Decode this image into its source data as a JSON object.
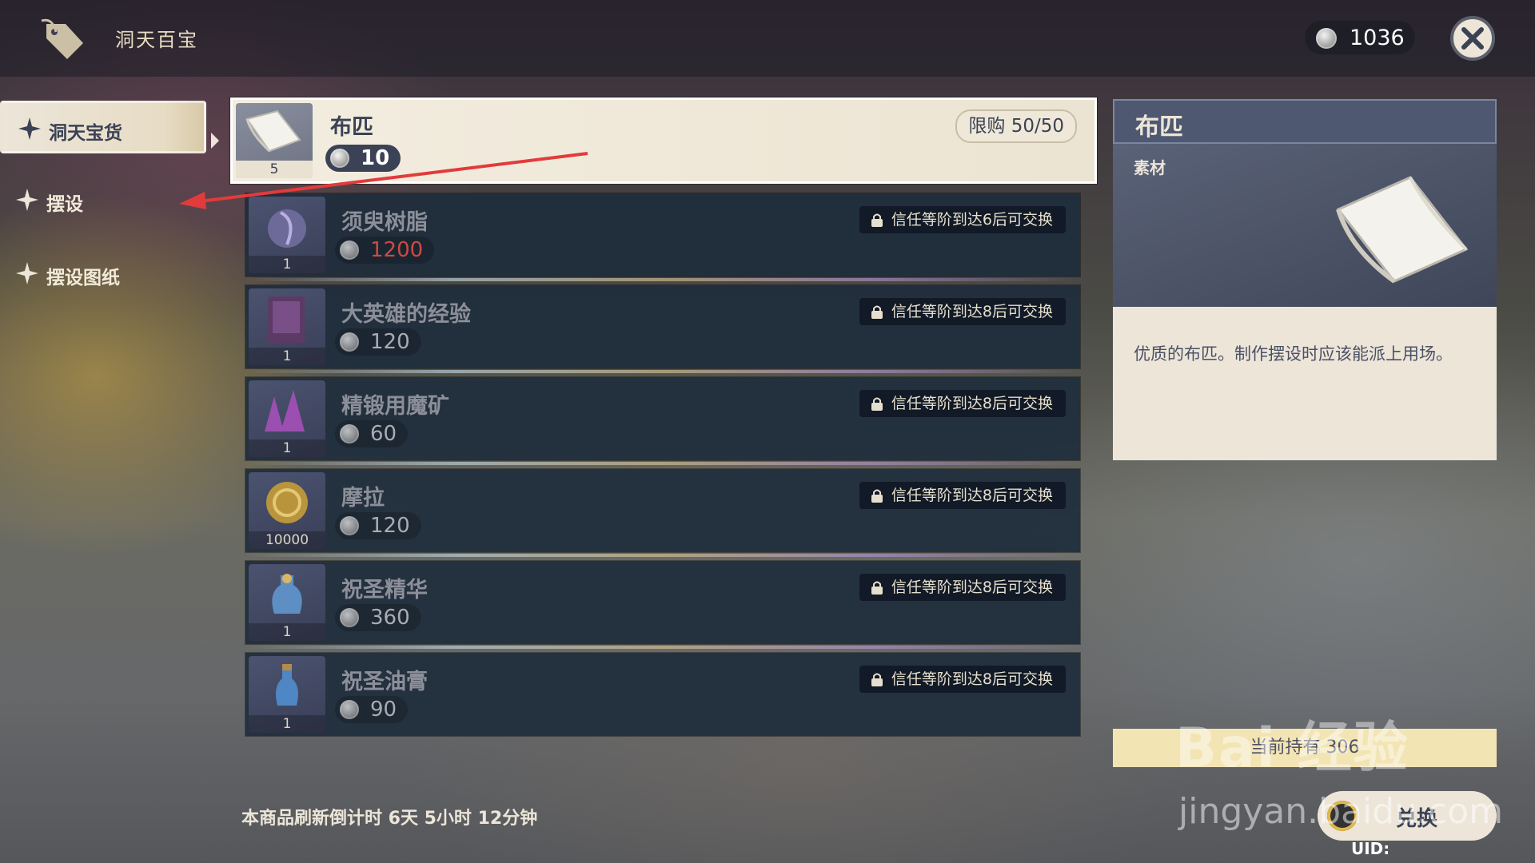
{
  "header": {
    "shop_icon": "shop-tag-icon",
    "title": "洞天百宝",
    "currency_icon": "realm-currency-coin-icon",
    "currency_value": "1036",
    "close_icon": "close-icon"
  },
  "nav": {
    "items": [
      {
        "label": "洞天宝货",
        "icon": "sparkle-star-icon",
        "active": true
      },
      {
        "label": "摆设",
        "icon": "sparkle-star-icon",
        "active": false
      },
      {
        "label": "摆设图纸",
        "icon": "sparkle-star-icon",
        "active": false
      }
    ]
  },
  "items": [
    {
      "name": "布匹",
      "count": "5",
      "price": "10",
      "limit": "限购 50/50",
      "icon": "fabric-icon",
      "selected": true
    },
    {
      "name": "须臾树脂",
      "count": "1",
      "price": "1200",
      "price_color": "#cc4a43",
      "lock": "信任等阶到达6后可交换",
      "icon": "fragile-resin-icon"
    },
    {
      "name": "大英雄的经验",
      "count": "1",
      "price": "120",
      "lock": "信任等阶到达8后可交换",
      "icon": "heros-wit-book-icon"
    },
    {
      "name": "精锻用魔矿",
      "count": "1",
      "price": "60",
      "lock": "信任等阶到达8后可交换",
      "icon": "mystic-ore-icon"
    },
    {
      "name": "摩拉",
      "count": "10000",
      "price": "120",
      "lock": "信任等阶到达8后可交换",
      "icon": "mora-coin-icon"
    },
    {
      "name": "祝圣精华",
      "count": "1",
      "price": "360",
      "lock": "信任等阶到达8后可交换",
      "icon": "sanctifying-essence-icon"
    },
    {
      "name": "祝圣油膏",
      "count": "1",
      "price": "90",
      "lock": "信任等阶到达8后可交换",
      "icon": "sanctifying-unction-icon"
    }
  ],
  "detail": {
    "name": "布匹",
    "type": "素材",
    "art_icon": "fabric-icon",
    "description": "优质的布匹。制作摆设时应该能派上用场。"
  },
  "footer": {
    "refresh": "本商品刷新倒计时 6天 5小时 12分钟",
    "owned": "当前持有 306",
    "exchange_label": "兑换",
    "uid": "UID:"
  },
  "watermark": {
    "brand": "Bai  经验",
    "url": "jingyan.baidu.com"
  },
  "colors": {
    "accent_cream": "#ece5d8",
    "navy": "#3b4255",
    "locked_price_red": "#cc4a43",
    "owned_bar": "#f3e4b3"
  }
}
